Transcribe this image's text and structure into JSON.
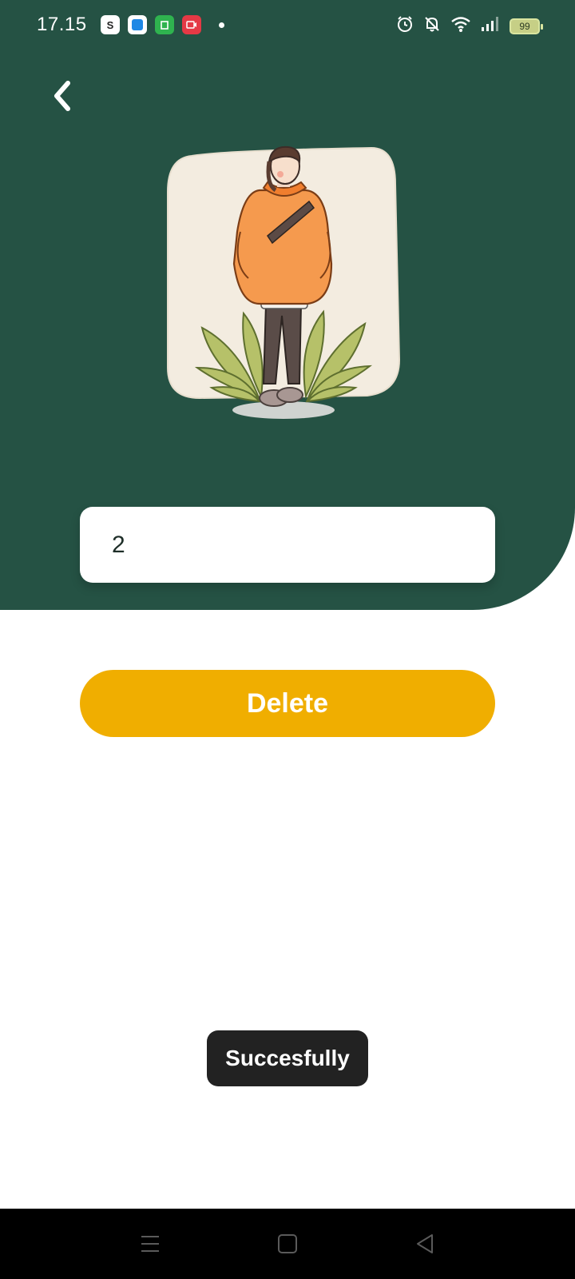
{
  "status_bar": {
    "time": "17.15",
    "battery": "99",
    "notification_icons": [
      "shopee-icon",
      "blue-app-icon",
      "green-app-icon",
      "red-app-icon",
      "dot-icon"
    ],
    "system_icons": [
      "alarm-icon",
      "mute-icon",
      "wifi-icon",
      "signal-icon",
      "battery-icon"
    ]
  },
  "header": {
    "back_icon": "chevron-left-icon"
  },
  "form": {
    "input_value": "2",
    "delete_label": "Delete"
  },
  "toast": {
    "message": "Succesfully"
  },
  "nav_bar": {
    "icons": [
      "menu-icon",
      "home-icon",
      "back-triangle-icon"
    ]
  },
  "colors": {
    "background_green": "#255244",
    "button_yellow": "#f0ae00",
    "toast_bg": "#222222"
  }
}
